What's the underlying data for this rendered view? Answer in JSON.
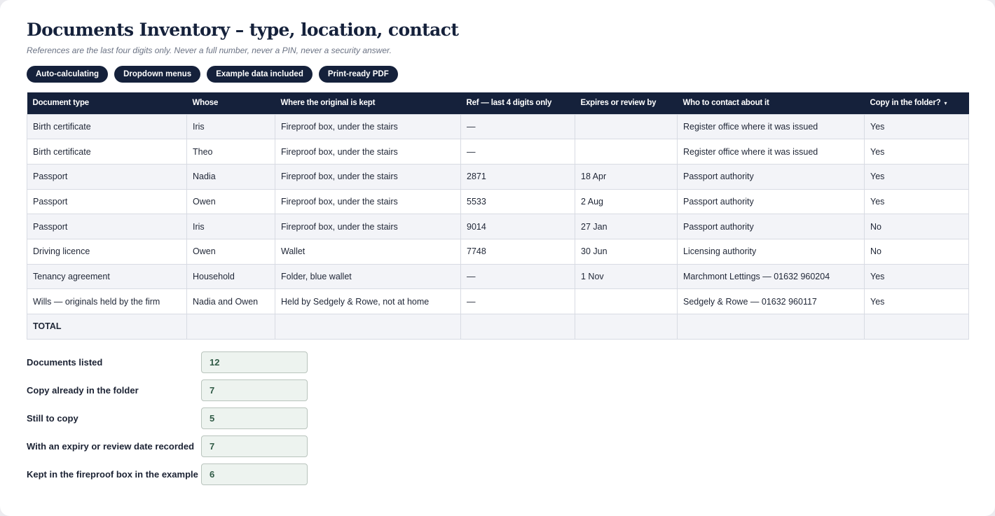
{
  "header": {
    "title": "Documents Inventory – type, location, contact",
    "subtitle": "References are the last four digits only. Never a full number, never a PIN, never a security answer."
  },
  "badges": [
    "Auto-calculating",
    "Dropdown menus",
    "Example data included",
    "Print-ready PDF"
  ],
  "table": {
    "columns": [
      "Document type",
      "Whose",
      "Where the original is kept",
      "Ref — last 4 digits only",
      "Expires or review by",
      "Who to contact about it",
      "Copy in the folder?"
    ],
    "filter_caret": "▾",
    "rows": [
      [
        "Birth certificate",
        "Iris",
        "Fireproof box, under the stairs",
        "—",
        "",
        "Register office where it was issued",
        "Yes"
      ],
      [
        "Birth certificate",
        "Theo",
        "Fireproof box, under the stairs",
        "—",
        "",
        "Register office where it was issued",
        "Yes"
      ],
      [
        "Passport",
        "Nadia",
        "Fireproof box, under the stairs",
        "2871",
        "18 Apr",
        "Passport authority",
        "Yes"
      ],
      [
        "Passport",
        "Owen",
        "Fireproof box, under the stairs",
        "5533",
        "2 Aug",
        "Passport authority",
        "Yes"
      ],
      [
        "Passport",
        "Iris",
        "Fireproof box, under the stairs",
        "9014",
        "27 Jan",
        "Passport authority",
        "No"
      ],
      [
        "Driving licence",
        "Owen",
        "Wallet",
        "7748",
        "30 Jun",
        "Licensing authority",
        "No"
      ],
      [
        "Tenancy agreement",
        "Household",
        "Folder, blue wallet",
        "—",
        "1 Nov",
        "Marchmont Lettings — 01632 960204",
        "Yes"
      ],
      [
        "Wills — originals held by the firm",
        "Nadia and Owen",
        "Held by Sedgely & Rowe, not at home",
        "—",
        "",
        "Sedgely & Rowe — 01632 960117",
        "Yes"
      ]
    ],
    "total_label": "TOTAL"
  },
  "summary": [
    {
      "label": "Documents listed",
      "value": "12"
    },
    {
      "label": "Copy already in the folder",
      "value": "7"
    },
    {
      "label": "Still to copy",
      "value": "5"
    },
    {
      "label": "With an expiry or review date recorded",
      "value": "7"
    },
    {
      "label": "Kept in the fireproof box in the example",
      "value": "6"
    }
  ],
  "colors": {
    "navy": "#15213b",
    "summary_fill": "#edf3ef",
    "summary_text": "#2f5a45"
  }
}
